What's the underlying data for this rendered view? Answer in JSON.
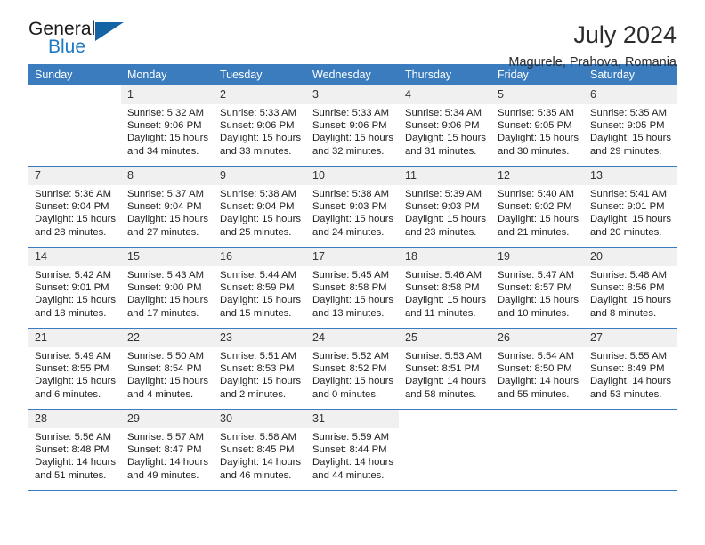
{
  "brand": {
    "name_part1": "General",
    "name_part2": "Blue",
    "logo_icon": "triangle-logo-icon"
  },
  "header": {
    "month_title": "July 2024",
    "location": "Magurele, Prahova, Romania"
  },
  "theme": {
    "header_blue": "#3a7cbe",
    "brand_blue": "#1f7ac4",
    "daynum_bg": "#f0f0f0",
    "text": "#1e1e1e"
  },
  "calendar": {
    "weekday_headers": [
      "Sunday",
      "Monday",
      "Tuesday",
      "Wednesday",
      "Thursday",
      "Friday",
      "Saturday"
    ],
    "labels": {
      "sunrise": "Sunrise:",
      "sunset": "Sunset:",
      "daylight": "Daylight:"
    },
    "weeks": [
      [
        {
          "day": "",
          "sunrise": "",
          "sunset": "",
          "daylight_line1": "",
          "daylight_line2": "",
          "blank": true
        },
        {
          "day": "1",
          "sunrise": "Sunrise: 5:32 AM",
          "sunset": "Sunset: 9:06 PM",
          "daylight_line1": "Daylight: 15 hours",
          "daylight_line2": "and 34 minutes."
        },
        {
          "day": "2",
          "sunrise": "Sunrise: 5:33 AM",
          "sunset": "Sunset: 9:06 PM",
          "daylight_line1": "Daylight: 15 hours",
          "daylight_line2": "and 33 minutes."
        },
        {
          "day": "3",
          "sunrise": "Sunrise: 5:33 AM",
          "sunset": "Sunset: 9:06 PM",
          "daylight_line1": "Daylight: 15 hours",
          "daylight_line2": "and 32 minutes."
        },
        {
          "day": "4",
          "sunrise": "Sunrise: 5:34 AM",
          "sunset": "Sunset: 9:06 PM",
          "daylight_line1": "Daylight: 15 hours",
          "daylight_line2": "and 31 minutes."
        },
        {
          "day": "5",
          "sunrise": "Sunrise: 5:35 AM",
          "sunset": "Sunset: 9:05 PM",
          "daylight_line1": "Daylight: 15 hours",
          "daylight_line2": "and 30 minutes."
        },
        {
          "day": "6",
          "sunrise": "Sunrise: 5:35 AM",
          "sunset": "Sunset: 9:05 PM",
          "daylight_line1": "Daylight: 15 hours",
          "daylight_line2": "and 29 minutes."
        }
      ],
      [
        {
          "day": "7",
          "sunrise": "Sunrise: 5:36 AM",
          "sunset": "Sunset: 9:04 PM",
          "daylight_line1": "Daylight: 15 hours",
          "daylight_line2": "and 28 minutes."
        },
        {
          "day": "8",
          "sunrise": "Sunrise: 5:37 AM",
          "sunset": "Sunset: 9:04 PM",
          "daylight_line1": "Daylight: 15 hours",
          "daylight_line2": "and 27 minutes."
        },
        {
          "day": "9",
          "sunrise": "Sunrise: 5:38 AM",
          "sunset": "Sunset: 9:04 PM",
          "daylight_line1": "Daylight: 15 hours",
          "daylight_line2": "and 25 minutes."
        },
        {
          "day": "10",
          "sunrise": "Sunrise: 5:38 AM",
          "sunset": "Sunset: 9:03 PM",
          "daylight_line1": "Daylight: 15 hours",
          "daylight_line2": "and 24 minutes."
        },
        {
          "day": "11",
          "sunrise": "Sunrise: 5:39 AM",
          "sunset": "Sunset: 9:03 PM",
          "daylight_line1": "Daylight: 15 hours",
          "daylight_line2": "and 23 minutes."
        },
        {
          "day": "12",
          "sunrise": "Sunrise: 5:40 AM",
          "sunset": "Sunset: 9:02 PM",
          "daylight_line1": "Daylight: 15 hours",
          "daylight_line2": "and 21 minutes."
        },
        {
          "day": "13",
          "sunrise": "Sunrise: 5:41 AM",
          "sunset": "Sunset: 9:01 PM",
          "daylight_line1": "Daylight: 15 hours",
          "daylight_line2": "and 20 minutes."
        }
      ],
      [
        {
          "day": "14",
          "sunrise": "Sunrise: 5:42 AM",
          "sunset": "Sunset: 9:01 PM",
          "daylight_line1": "Daylight: 15 hours",
          "daylight_line2": "and 18 minutes."
        },
        {
          "day": "15",
          "sunrise": "Sunrise: 5:43 AM",
          "sunset": "Sunset: 9:00 PM",
          "daylight_line1": "Daylight: 15 hours",
          "daylight_line2": "and 17 minutes."
        },
        {
          "day": "16",
          "sunrise": "Sunrise: 5:44 AM",
          "sunset": "Sunset: 8:59 PM",
          "daylight_line1": "Daylight: 15 hours",
          "daylight_line2": "and 15 minutes."
        },
        {
          "day": "17",
          "sunrise": "Sunrise: 5:45 AM",
          "sunset": "Sunset: 8:58 PM",
          "daylight_line1": "Daylight: 15 hours",
          "daylight_line2": "and 13 minutes."
        },
        {
          "day": "18",
          "sunrise": "Sunrise: 5:46 AM",
          "sunset": "Sunset: 8:58 PM",
          "daylight_line1": "Daylight: 15 hours",
          "daylight_line2": "and 11 minutes."
        },
        {
          "day": "19",
          "sunrise": "Sunrise: 5:47 AM",
          "sunset": "Sunset: 8:57 PM",
          "daylight_line1": "Daylight: 15 hours",
          "daylight_line2": "and 10 minutes."
        },
        {
          "day": "20",
          "sunrise": "Sunrise: 5:48 AM",
          "sunset": "Sunset: 8:56 PM",
          "daylight_line1": "Daylight: 15 hours",
          "daylight_line2": "and 8 minutes."
        }
      ],
      [
        {
          "day": "21",
          "sunrise": "Sunrise: 5:49 AM",
          "sunset": "Sunset: 8:55 PM",
          "daylight_line1": "Daylight: 15 hours",
          "daylight_line2": "and 6 minutes."
        },
        {
          "day": "22",
          "sunrise": "Sunrise: 5:50 AM",
          "sunset": "Sunset: 8:54 PM",
          "daylight_line1": "Daylight: 15 hours",
          "daylight_line2": "and 4 minutes."
        },
        {
          "day": "23",
          "sunrise": "Sunrise: 5:51 AM",
          "sunset": "Sunset: 8:53 PM",
          "daylight_line1": "Daylight: 15 hours",
          "daylight_line2": "and 2 minutes."
        },
        {
          "day": "24",
          "sunrise": "Sunrise: 5:52 AM",
          "sunset": "Sunset: 8:52 PM",
          "daylight_line1": "Daylight: 15 hours",
          "daylight_line2": "and 0 minutes."
        },
        {
          "day": "25",
          "sunrise": "Sunrise: 5:53 AM",
          "sunset": "Sunset: 8:51 PM",
          "daylight_line1": "Daylight: 14 hours",
          "daylight_line2": "and 58 minutes."
        },
        {
          "day": "26",
          "sunrise": "Sunrise: 5:54 AM",
          "sunset": "Sunset: 8:50 PM",
          "daylight_line1": "Daylight: 14 hours",
          "daylight_line2": "and 55 minutes."
        },
        {
          "day": "27",
          "sunrise": "Sunrise: 5:55 AM",
          "sunset": "Sunset: 8:49 PM",
          "daylight_line1": "Daylight: 14 hours",
          "daylight_line2": "and 53 minutes."
        }
      ],
      [
        {
          "day": "28",
          "sunrise": "Sunrise: 5:56 AM",
          "sunset": "Sunset: 8:48 PM",
          "daylight_line1": "Daylight: 14 hours",
          "daylight_line2": "and 51 minutes."
        },
        {
          "day": "29",
          "sunrise": "Sunrise: 5:57 AM",
          "sunset": "Sunset: 8:47 PM",
          "daylight_line1": "Daylight: 14 hours",
          "daylight_line2": "and 49 minutes."
        },
        {
          "day": "30",
          "sunrise": "Sunrise: 5:58 AM",
          "sunset": "Sunset: 8:45 PM",
          "daylight_line1": "Daylight: 14 hours",
          "daylight_line2": "and 46 minutes."
        },
        {
          "day": "31",
          "sunrise": "Sunrise: 5:59 AM",
          "sunset": "Sunset: 8:44 PM",
          "daylight_line1": "Daylight: 14 hours",
          "daylight_line2": "and 44 minutes."
        },
        {
          "day": "",
          "sunrise": "",
          "sunset": "",
          "daylight_line1": "",
          "daylight_line2": "",
          "blank": true
        },
        {
          "day": "",
          "sunrise": "",
          "sunset": "",
          "daylight_line1": "",
          "daylight_line2": "",
          "blank": true
        },
        {
          "day": "",
          "sunrise": "",
          "sunset": "",
          "daylight_line1": "",
          "daylight_line2": "",
          "blank": true
        }
      ]
    ]
  }
}
